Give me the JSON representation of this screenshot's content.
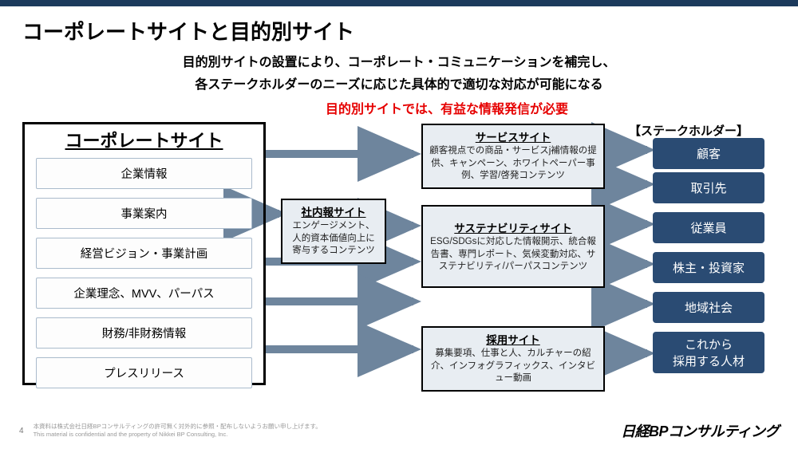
{
  "title": "コーポレートサイトと目的別サイト",
  "subtitle_line1": "目的別サイトの設置により、コーポレート・コミュニケーションを補完し、",
  "subtitle_line2": "各ステークホルダーのニーズに応じた具体的で適切な対応が可能になる",
  "emphasis": "目的別サイトでは、有益な情報発信が必要",
  "corporate": {
    "title": "コーポレートサイト",
    "items": [
      "企業情報",
      "事業案内",
      "経営ビジョン・事業計画",
      "企業理念、MVV、パーパス",
      "財務/非財務情報",
      "プレスリリース"
    ]
  },
  "purpose_sites": {
    "internal": {
      "title": "社内報サイト",
      "desc": "エンゲージメント、人的資本価値向上に寄与するコンテンツ"
    },
    "service": {
      "title": "サービスサイト",
      "desc": "顧客視点での商品・サービスj補情報の提供、キャンペーン、ホワイトペーパー事例、学習/啓発コンテンツ"
    },
    "sustain": {
      "title": "サステナビリティサイト",
      "desc": "ESG/SDGsに対応した情報開示、統合報告書、専門レポート、気候変動対応、サステナビリティ/パーパスコンテンツ"
    },
    "recruit": {
      "title": "採用サイト",
      "desc": "募集要項、仕事と人、カルチャーの紹介、インフォグラフィックス、インタビュー動画"
    }
  },
  "stakeholder_header": "【ステークホルダー】",
  "stakeholders": [
    "顧客",
    "取引先",
    "従業員",
    "株主・投資家",
    "地域社会",
    "これから\n採用する人材"
  ],
  "footer": {
    "page": "4",
    "disclaimer_jp": "本資料は株式会社日経BPコンサルティングの許可無く対外的に参照・配布しないようお願い申し上げます。",
    "disclaimer_en": "This material is confidential and the property of Nikkei BP Consulting, Inc.",
    "brand": "日経BPコンサルティング"
  }
}
